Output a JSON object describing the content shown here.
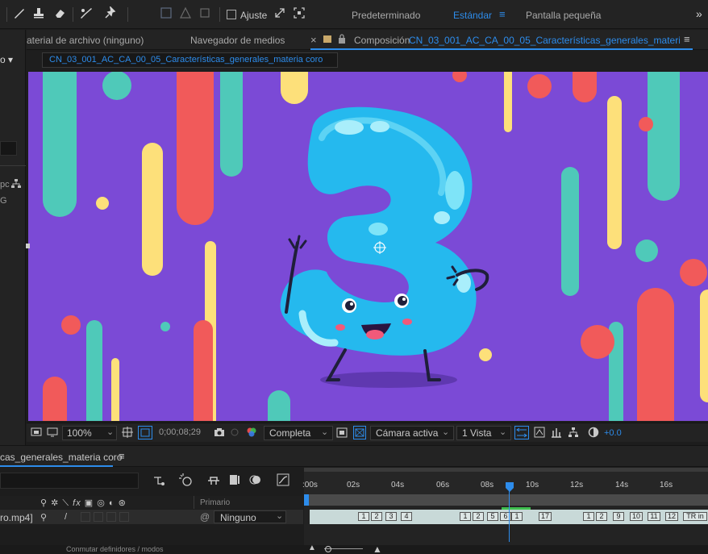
{
  "toolbar": {
    "snap_label": "Ajuste",
    "workspaces": [
      "Predeterminado",
      "Estándar",
      "Pantalla pequeña"
    ],
    "active_workspace": "Estándar",
    "overflow": "»"
  },
  "left_panel": {
    "dropdown_fragment": "o ▾",
    "text_fragment_1": "pc",
    "text_fragment_2": "G"
  },
  "tabs": {
    "footage": "aterial de archivo  (ninguno)",
    "media_browser": "Navegador de medios",
    "close": "×",
    "composition_prefix": "Composición",
    "composition_name": "CN_03_001_AC_CA_00_05_Características_generales_materia coro",
    "menu": "≡"
  },
  "comp_chip": "CN_03_001_AC_CA_00_05_Características_generales_materia coro",
  "viewer_controls": {
    "zoom": "100%",
    "timecode": "0;00;08;29",
    "resolution": "Completa",
    "camera": "Cámara activa",
    "views": "1 Vista",
    "exposure": "+0.0"
  },
  "timeline": {
    "panel_title": "cas_generales_materia coro",
    "menu": "≡",
    "column_header": "Primario",
    "layer_name": "ro.mp4]",
    "parent_value": "Ninguno",
    "ruler_ticks": [
      ":00s",
      "02s",
      "04s",
      "06s",
      "08s",
      "10s",
      "12s",
      "14s",
      "16s"
    ],
    "keyframes": [
      "1",
      "2",
      "3",
      "4",
      "1",
      "2",
      "5",
      "6",
      "1",
      "17",
      "1",
      "2",
      "9",
      "10",
      "11",
      "12",
      "TR in"
    ],
    "bottom_toggle": "Conmutar definidores / modos"
  },
  "colors": {
    "accent_blue": "#2d8ceb",
    "viewer_background": "#7b4ad6",
    "character": "#25b9ee",
    "teal": "#4fc9b9",
    "red": "#f15a5a",
    "yellow": "#fde07a",
    "playhead": "#2d8ceb"
  },
  "icons": [
    "brush-icon",
    "stamp-icon",
    "eraser-icon",
    "roto-brush-icon",
    "puppet-pin-icon",
    "snap-checkbox",
    "expand-icon",
    "grid-icon",
    "camera-icon",
    "color-channel-icon",
    "region-icon",
    "transparency-icon",
    "fast-preview-icon",
    "flowchart-icon"
  ]
}
